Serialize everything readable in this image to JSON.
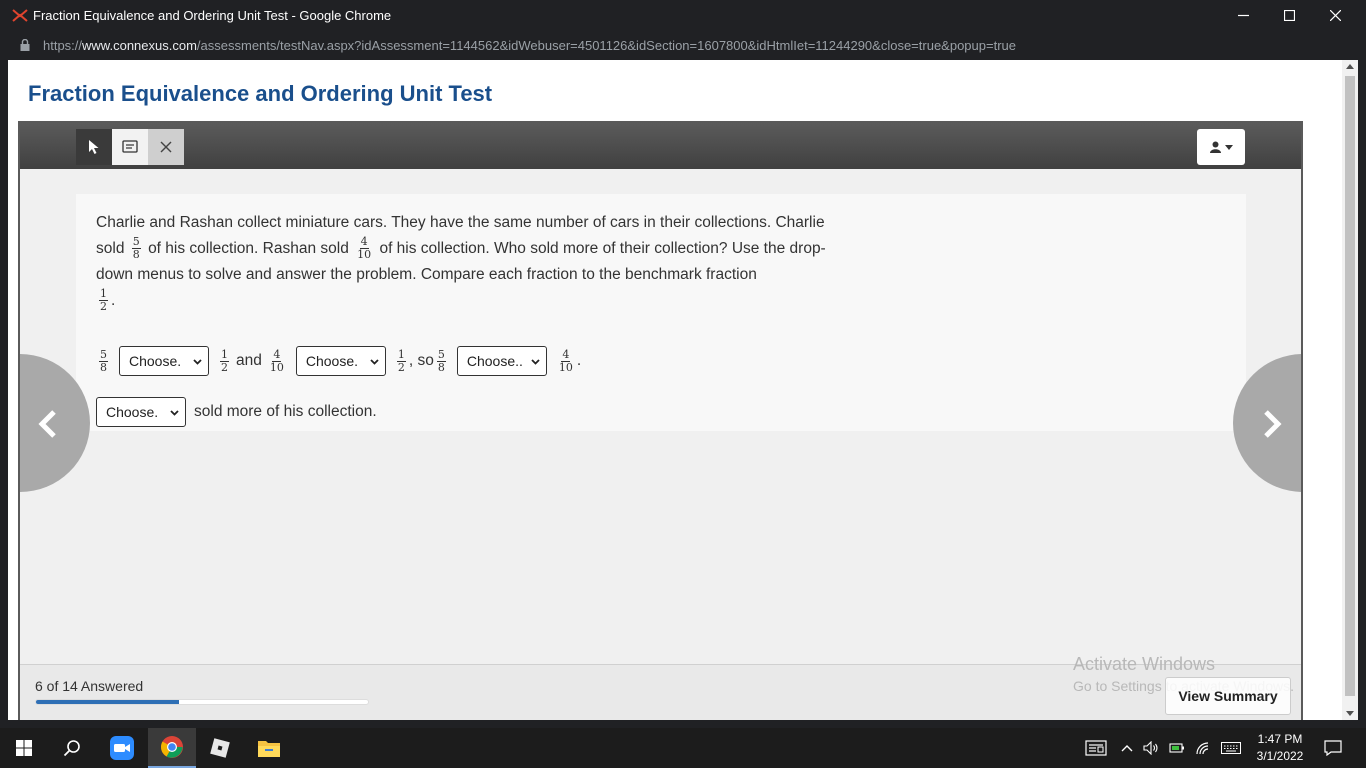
{
  "browser": {
    "window_title": "Fraction Equivalence and Ordering Unit Test - Google Chrome",
    "url_prefix": "https://",
    "url_domain": "www.connexus.com",
    "url_path": "/assessments/testNav.aspx?idAssessment=1144562&idWebuser=4501126&idSection=1607800&idHtmlIet=11244290&close=true&popup=true"
  },
  "page": {
    "title": "Fraction Equivalence and Ordering Unit Test"
  },
  "question": {
    "part1": "Charlie and Rashan collect miniature cars. They have the same number of cars in their collections. Charlie sold",
    "frac_charlie": {
      "num": "5",
      "den": "8"
    },
    "part2": "of his collection. Rashan sold",
    "frac_rashan": {
      "num": "4",
      "den": "10"
    },
    "part3": "of his collection. Who sold more of their collection? Use the drop-down menus to solve and answer the problem. Compare each fraction to the benchmark fraction",
    "frac_benchmark": {
      "num": "1",
      "den": "2"
    },
    "end_period": "."
  },
  "row1": {
    "frac_a": {
      "num": "5",
      "den": "8"
    },
    "select1": "Choose.",
    "frac_b": {
      "num": "1",
      "den": "2"
    },
    "and_text": "and",
    "frac_c": {
      "num": "4",
      "den": "10"
    },
    "select2": "Choose.",
    "frac_d": {
      "num": "1",
      "den": "2"
    },
    "so_text": ", so",
    "frac_e": {
      "num": "5",
      "den": "8"
    },
    "select3": "Choose..",
    "frac_f": {
      "num": "4",
      "den": "10"
    },
    "period": "."
  },
  "row2": {
    "select4": "Choose.",
    "text": "sold more of his collection."
  },
  "footer": {
    "answered_text": "6 of 14 Answered",
    "progress": 0.43,
    "view_summary": "View Summary",
    "watermark_title": "Activate Windows",
    "watermark_sub": "Go to Settings to activate Windows."
  },
  "taskbar": {
    "time": "1:47 PM",
    "date": "3/1/2022"
  },
  "colors": {
    "title_blue": "#1a4f8c",
    "progress_blue": "#2e6fb5"
  }
}
